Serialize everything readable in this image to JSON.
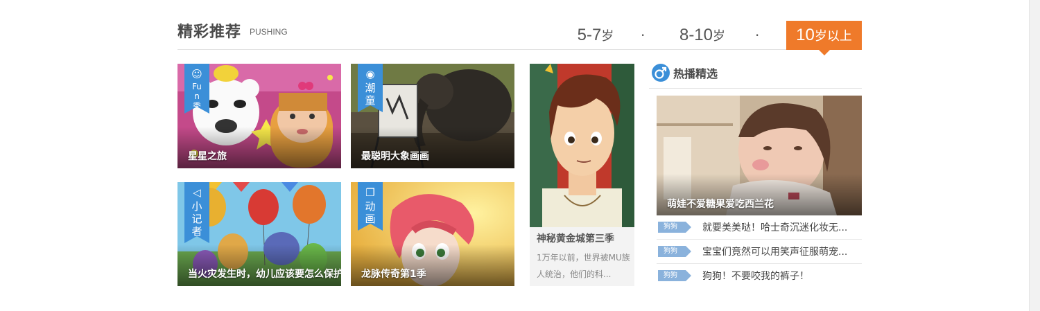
{
  "header": {
    "title": "精彩推荐",
    "subtitle": "PUSHING"
  },
  "age_tabs": [
    {
      "number": "5-7",
      "unit": "岁",
      "active": false
    },
    {
      "number": "8-10",
      "unit": "岁",
      "active": false
    },
    {
      "number": "10",
      "unit": "岁以上",
      "active": true
    }
  ],
  "age_separator": "·",
  "tiles": [
    {
      "caption": "星星之旅",
      "badge_icon": "☺",
      "badge_text": "Fun秀"
    },
    {
      "caption": "最聪明大象画画",
      "badge_icon": "◉",
      "badge_text": "潮童"
    },
    {
      "caption": "当火灾发生时，幼儿应该要怎么保护",
      "badge_icon": "◁",
      "badge_text": "小记者"
    },
    {
      "caption": "龙脉传奇第1季",
      "badge_icon": "❐",
      "badge_text": "动画"
    }
  ],
  "tall_card": {
    "title": "神秘黄金城第三季",
    "description": "1万年以前，世界被MU族人统治，他们的科..."
  },
  "hot": {
    "title": "热播精选",
    "icon": "male-symbol-icon",
    "feature_caption": "萌娃不爱糖果爱吃西兰花",
    "items": [
      {
        "tag": "狗狗",
        "title": "就要美美哒！哈士奇沉迷化妆无..."
      },
      {
        "tag": "狗狗",
        "title": "宝宝们竟然可以用笑声征服萌宠..."
      },
      {
        "tag": "狗狗",
        "title": "狗狗！不要咬我的裤子！"
      }
    ]
  },
  "colors": {
    "accent": "#ef7a2a",
    "badge_blue": "#3b8fd8",
    "tag_blue": "#8ab2dc"
  }
}
